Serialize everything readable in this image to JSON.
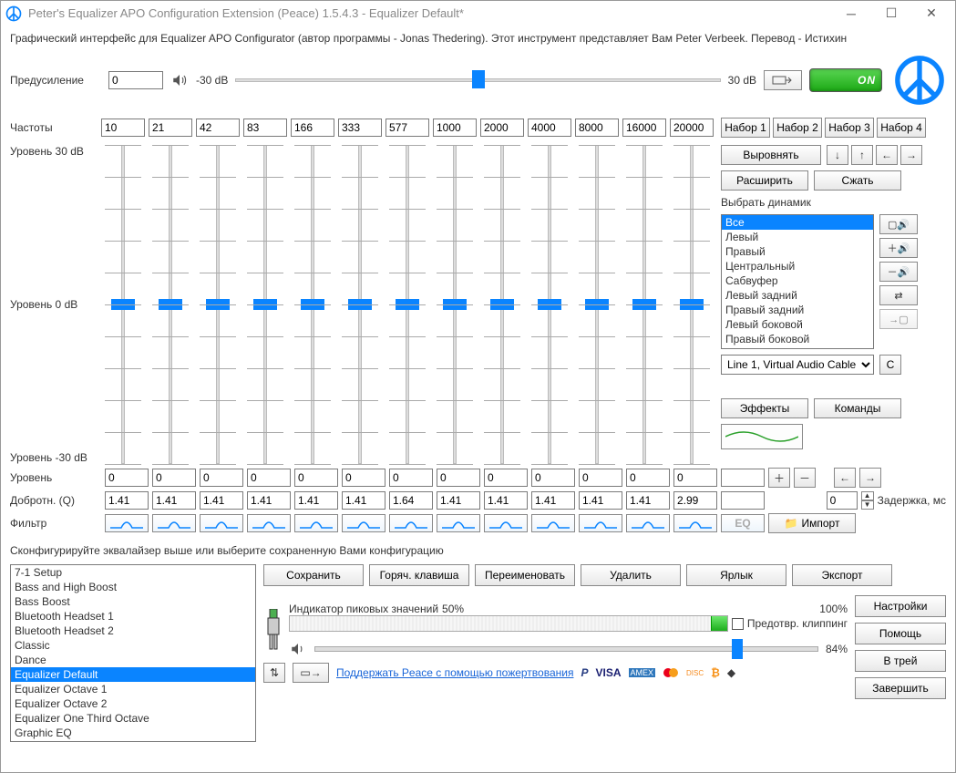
{
  "window": {
    "title": "Peter's Equalizer APO Configuration Extension (Peace) 1.5.4.3 - Equalizer Default*"
  },
  "description": "Графический интерфейс для Equalizer APO Configurator (автор программы - Jonas Thedering). Этот инструмент представляет Вам Peter Verbeek. Перевод - Истихин",
  "preamp": {
    "label": "Предусиление",
    "value": "0",
    "min_label": "-30 dB",
    "max_label": "30 dB",
    "on_label": "ON"
  },
  "freq": {
    "label": "Частоты",
    "values": [
      "10",
      "21",
      "42",
      "83",
      "166",
      "333",
      "577",
      "1000",
      "2000",
      "4000",
      "8000",
      "16000",
      "20000"
    ],
    "sets": [
      "Набор 1",
      "Набор 2",
      "Набор 3",
      "Набор 4"
    ]
  },
  "slider_labels": {
    "top": "Уровень 30 dB",
    "mid": "Уровень 0 dB",
    "bot": "Уровень -30 dB"
  },
  "right": {
    "align": "Выровнять",
    "expand": "Расширить",
    "compress": "Сжать",
    "choose_speaker": "Выбрать динамик",
    "speakers": [
      "Все",
      "Левый",
      "Правый",
      "Центральный",
      "Сабвуфер",
      "Левый задний",
      "Правый задний",
      "Левый боковой",
      "Правый боковой"
    ],
    "speaker_selected": 0,
    "device": "Line 1, Virtual Audio Cable",
    "device_btn": "C",
    "effects": "Эффекты",
    "commands": "Команды"
  },
  "levels": {
    "label": "Уровень",
    "values": [
      "0",
      "0",
      "0",
      "0",
      "0",
      "0",
      "0",
      "0",
      "0",
      "0",
      "0",
      "0",
      "0"
    ]
  },
  "q": {
    "label": "Добротн. (Q)",
    "values": [
      "1.41",
      "1.41",
      "1.41",
      "1.41",
      "1.41",
      "1.41",
      "1.64",
      "1.41",
      "1.41",
      "1.41",
      "1.41",
      "1.41",
      "2.99"
    ]
  },
  "delay": {
    "value": "0",
    "label": "Задержка, мс"
  },
  "filter": {
    "label": "Фильтр",
    "import": "Импорт"
  },
  "instruction": "Сконфигурируйте эквалайзер выше или выберите сохраненную Вами конфигурацию",
  "presets": [
    "7-1 Setup",
    "Bass and High Boost",
    "Bass Boost",
    "Bluetooth Headset 1",
    "Bluetooth Headset 2",
    "Classic",
    "Dance",
    "Equalizer Default",
    "Equalizer Octave 1",
    "Equalizer Octave 2",
    "Equalizer One Third Octave",
    "Graphic EQ"
  ],
  "preset_selected": 7,
  "actions": {
    "save": "Сохранить",
    "hotkey": "Горяч. клавиша",
    "rename": "Переименовать",
    "delete": "Удалить",
    "shortcut": "Ярлык",
    "export": "Экспорт"
  },
  "indicator": {
    "label": "Индикатор пиковых значений",
    "p50": "50%",
    "p100": "100%",
    "clip": "Предотвр. клиппинг"
  },
  "volume": {
    "percent": "84%"
  },
  "footer": {
    "donate": "Поддержать Peace с помощью пожертвования"
  },
  "nav": {
    "settings": "Настройки",
    "help": "Помощь",
    "tray": "В трей",
    "exit": "Завершить"
  }
}
